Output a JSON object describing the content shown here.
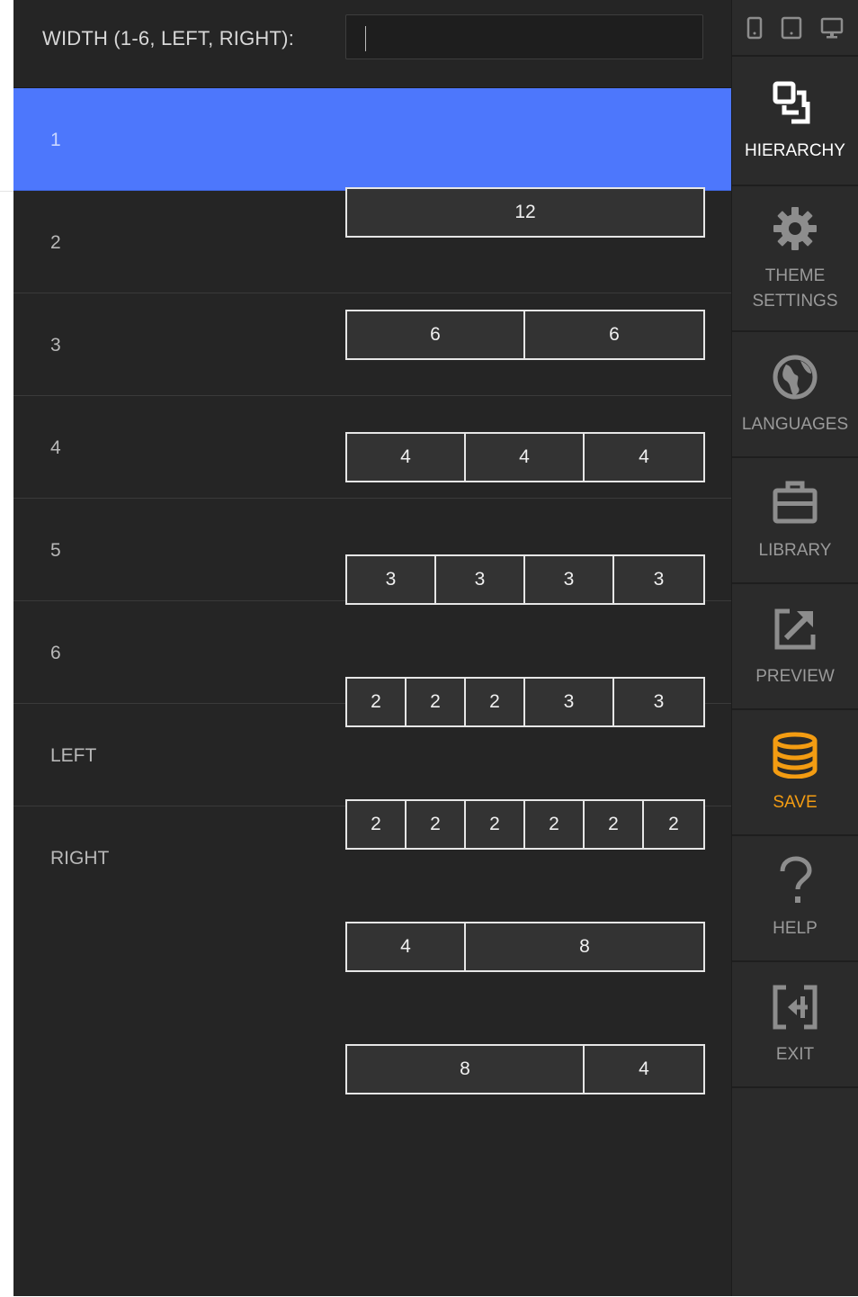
{
  "panel": {
    "width_label": "WIDTH (1-6, LEFT, RIGHT):",
    "width_input_value": ""
  },
  "rows": [
    {
      "label": "1",
      "selected": true
    },
    {
      "label": "2"
    },
    {
      "label": "3"
    },
    {
      "label": "4"
    },
    {
      "label": "5"
    },
    {
      "label": "6"
    },
    {
      "label": "LEFT"
    },
    {
      "label": "RIGHT"
    }
  ],
  "grid_options": [
    [
      "12"
    ],
    [
      "6",
      "6"
    ],
    [
      "4",
      "4",
      "4"
    ],
    [
      "3",
      "3",
      "3",
      "3"
    ],
    [
      "2",
      "2",
      "2",
      "3",
      "3"
    ],
    [
      "2",
      "2",
      "2",
      "2",
      "2",
      "2"
    ],
    [
      "4",
      "8"
    ],
    [
      "8",
      "4"
    ]
  ],
  "sidebar": {
    "devices": [
      "phone-icon",
      "tablet-icon",
      "desktop-icon"
    ],
    "items": [
      {
        "label": "HIERARCHY",
        "icon": "hierarchy-icon",
        "active": true
      },
      {
        "label_line1": "THEME",
        "label_line2": "SETTINGS",
        "icon": "gear-icon"
      },
      {
        "label": "LANGUAGES",
        "icon": "globe-icon"
      },
      {
        "label": "LIBRARY",
        "icon": "briefcase-icon"
      },
      {
        "label": "PREVIEW",
        "icon": "external-link-icon"
      },
      {
        "label": "SAVE",
        "icon": "database-icon",
        "color": "#f39c12"
      },
      {
        "label": "HELP",
        "icon": "question-icon"
      },
      {
        "label": "EXIT",
        "icon": "exit-icon"
      }
    ]
  },
  "colors": {
    "selected_row": "#4d77fc",
    "panel_bg": "#252525",
    "sidebar_bg": "#2b2b2b",
    "save_accent": "#f39c12"
  }
}
